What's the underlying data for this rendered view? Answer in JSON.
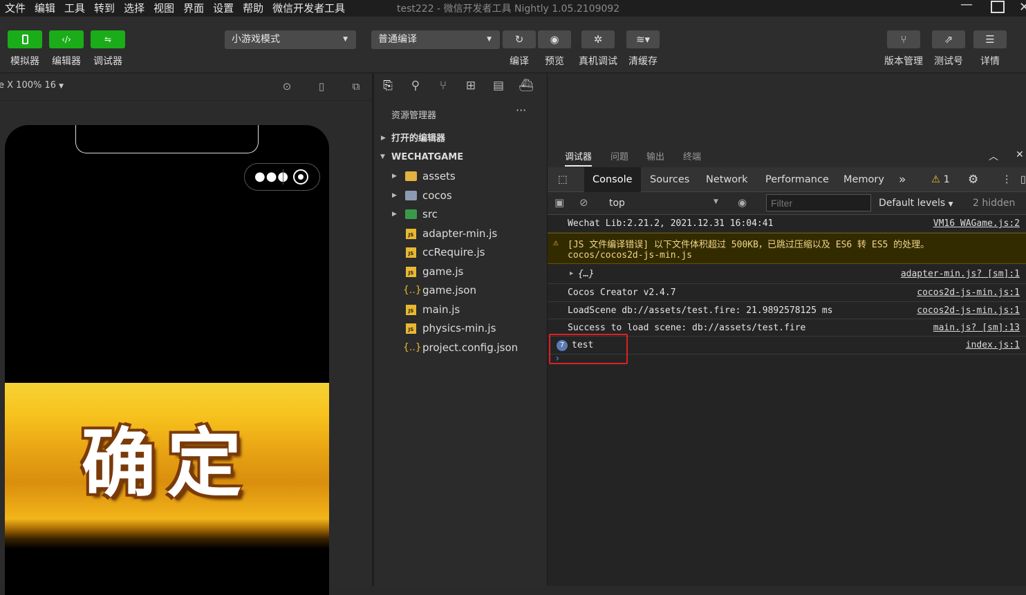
{
  "menubar": {
    "items": [
      "文件",
      "编辑",
      "工具",
      "转到",
      "选择",
      "视图",
      "界面",
      "设置",
      "帮助",
      "微信开发者工具"
    ],
    "window_title": "test222 - 微信开发者工具 Nightly 1.05.2109092"
  },
  "toolbar": {
    "left_buttons": [
      {
        "label": "模拟器",
        "icon": "phone-icon"
      },
      {
        "label": "编辑器",
        "icon": "code-icon"
      },
      {
        "label": "调试器",
        "icon": "debug-icon"
      }
    ],
    "mode_select": "小游戏模式",
    "compile_select": "普通编译",
    "actions": [
      {
        "label": "编译",
        "icon": "refresh-icon"
      },
      {
        "label": "预览",
        "icon": "eye-icon"
      },
      {
        "label": "真机调试",
        "icon": "bug-icon"
      },
      {
        "label": "清缓存",
        "icon": "layers-icon"
      }
    ],
    "right_actions": [
      {
        "label": "版本管理",
        "icon": "branch-icon"
      },
      {
        "label": "测试号",
        "icon": "share-icon"
      },
      {
        "label": "详情",
        "icon": "menu-icon"
      }
    ]
  },
  "simulator": {
    "device_label": "e X 100% 16",
    "game_text": "确定"
  },
  "explorer": {
    "title": "资源管理器",
    "more": "···",
    "open_editors": "打开的编辑器",
    "project": "WECHATGAME",
    "items": [
      {
        "name": "assets",
        "type": "folder-yellow"
      },
      {
        "name": "cocos",
        "type": "folder"
      },
      {
        "name": "src",
        "type": "folder-green"
      },
      {
        "name": "adapter-min.js",
        "type": "js"
      },
      {
        "name": "ccRequire.js",
        "type": "js"
      },
      {
        "name": "game.js",
        "type": "js"
      },
      {
        "name": "game.json",
        "type": "json"
      },
      {
        "name": "main.js",
        "type": "js"
      },
      {
        "name": "physics-min.js",
        "type": "js"
      },
      {
        "name": "project.config.json",
        "type": "json"
      }
    ]
  },
  "debugger": {
    "tabs": [
      "调试器",
      "问题",
      "输出",
      "终端"
    ],
    "devtools_tabs": [
      "Console",
      "Sources",
      "Network",
      "Performance",
      "Memory"
    ],
    "more_tabs": "»",
    "warning_count": "1",
    "context": "top",
    "filter_placeholder": "Filter",
    "levels": "Default levels",
    "hidden": "2 hidden",
    "logs": [
      {
        "msg": "Wechat Lib:2.21.2, 2021.12.31 16:04:41",
        "src": "VM16 WAGame.js:2"
      },
      {
        "msg": "[JS 文件编译错误] 以下文件体积超过 500KB，已跳过压缩以及 ES6 转 ES5 的处理。",
        "msg2": "cocos/cocos2d-js-min.js",
        "src": ""
      },
      {
        "msg": "{…}",
        "src": "adapter-min.js? [sm]:1"
      },
      {
        "msg": "Cocos Creator v2.4.7",
        "src": "cocos2d-js-min.js:1"
      },
      {
        "msg": "LoadScene db://assets/test.fire: 21.9892578125 ms",
        "src": "cocos2d-js-min.js:1"
      },
      {
        "msg": "Success to load scene: db://assets/test.fire",
        "src": "main.js? [sm]:13"
      },
      {
        "msg": "test",
        "count": "7",
        "src": "index.js:1"
      }
    ],
    "prompt": "›"
  }
}
